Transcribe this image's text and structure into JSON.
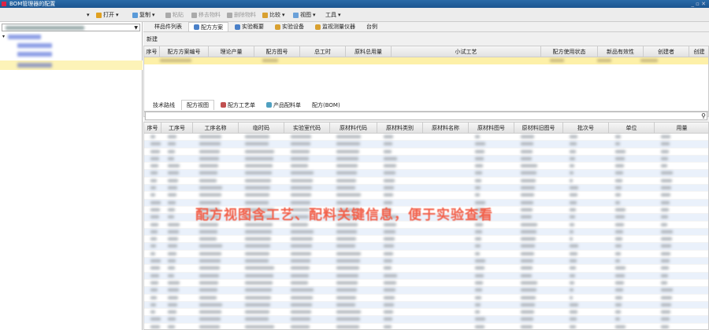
{
  "window": {
    "title": "BOM管理器的配置"
  },
  "toolbar": {
    "open": "打开",
    "copy": "复制",
    "paste": "粘贴",
    "remove_material": "移去物料",
    "delete_material": "删除物料",
    "compare": "比较",
    "view": "视图",
    "tools": "工具"
  },
  "top_tabs": [
    "样品件列表",
    "配方方案",
    "实验概要",
    "实验设备",
    "监视测量仪器",
    "台例"
  ],
  "new_label": "新建",
  "recipe_columns": [
    "序号",
    "配方方案编号",
    "理论产量",
    "配方图号",
    "总工时",
    "原料总用量",
    "小试工艺",
    "配方使用状态",
    "新品有效性",
    "创建者",
    "创建"
  ],
  "bottom_tabs": [
    "技术路线",
    "配方视图",
    "配方工艺单",
    "产品配料单",
    "配方(BOM)"
  ],
  "view_columns": [
    "序号",
    "工序号",
    "工序名称",
    "临时码",
    "实验室代码",
    "原材料代码",
    "原材料类别",
    "原材料名称",
    "原材料图号",
    "原材料旧图号",
    "批次号",
    "单位",
    "用量"
  ],
  "overlay_text": "配方视图含工艺、配料关键信息，便于实验查看",
  "colors": {
    "title_bar": "#1b5590",
    "selected_row": "#fdf0a8",
    "overlay": "#f2604a"
  }
}
